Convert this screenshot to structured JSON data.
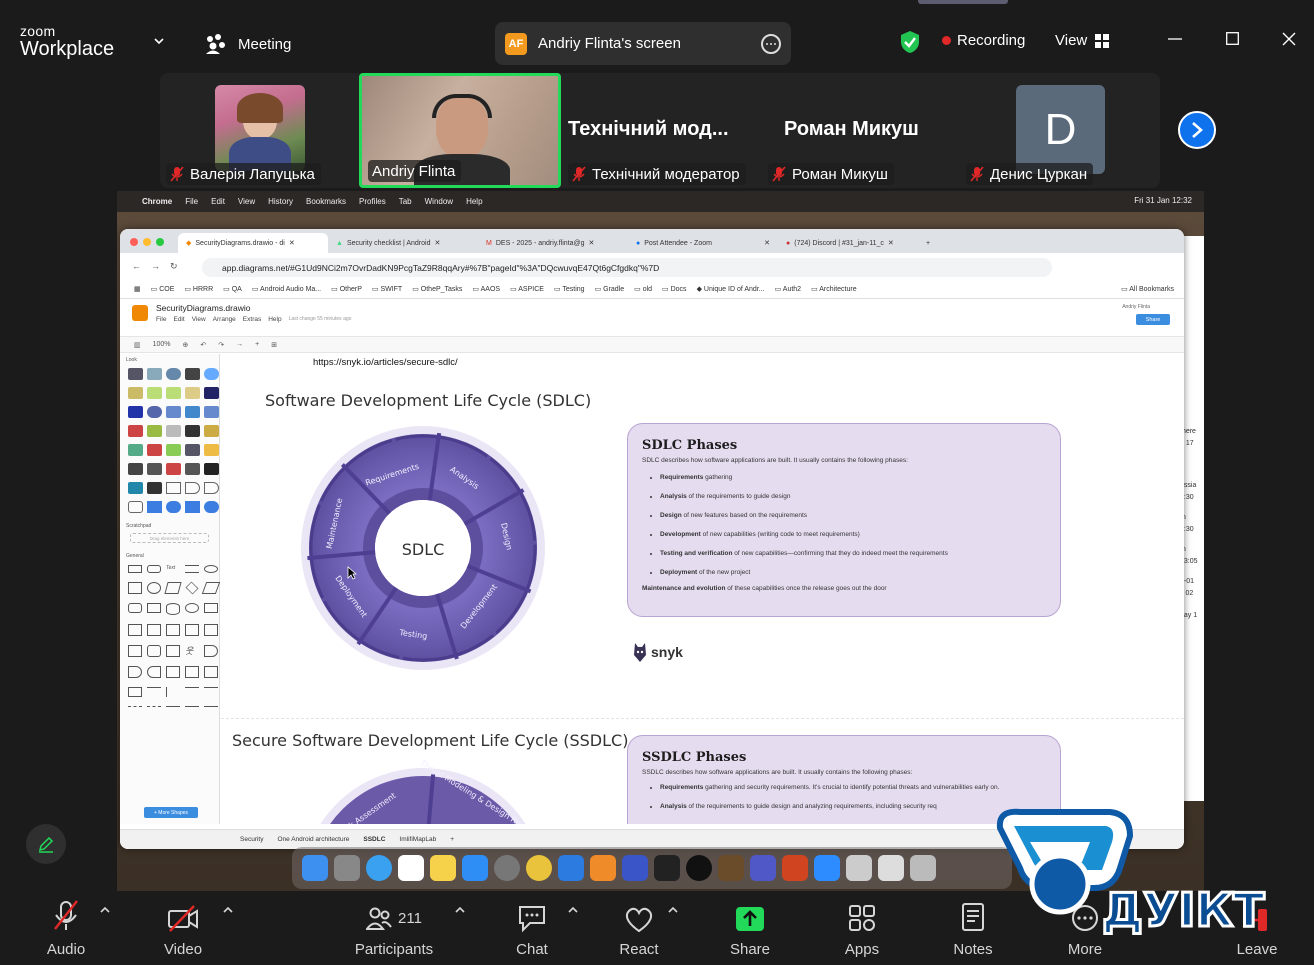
{
  "app": {
    "logo_line1": "zoom",
    "logo_line2": "Workplace"
  },
  "header": {
    "meeting_label": "Meeting",
    "share_initials": "AF",
    "share_label": "Andriy Flinta's screen",
    "recording_label": "Recording",
    "view_label": "View"
  },
  "participants": [
    {
      "name": "Валерія Лапуцька",
      "muted": true
    },
    {
      "name": "Andriy Flinta",
      "muted": false,
      "speaking": true
    },
    {
      "display": "Технічний мод...",
      "name": "Технічний модератор",
      "muted": true
    },
    {
      "display": "Роман Микуш",
      "name": "Роман Микуш",
      "muted": false
    },
    {
      "avatar_letter": "D",
      "name": "Денис Цуркан",
      "muted": true
    }
  ],
  "mac_menu": {
    "items": [
      "Chrome",
      "File",
      "Edit",
      "View",
      "History",
      "Bookmarks",
      "Profiles",
      "Tab",
      "Window",
      "Help"
    ],
    "clock": "Fri 31 Jan  12:32"
  },
  "browser": {
    "tabs": [
      "SecurityDiagrams.drawio - di",
      "Security checklist | Android",
      "DES - 2025 - andriy.flinta@g",
      "Post Attendee - Zoom",
      "(724) Discord | #31_jan-11_c"
    ],
    "url": "app.diagrams.net/#G1Ud9NCi2m7OvrDadKN9PcgTaZ9R8qqAry#%7B\"pageId\"%3A\"DQcwuvqE47Qt6gCfgdkq\"%7D",
    "bookmarks": [
      "COE",
      "HRRR",
      "QA",
      "Android Audio Ma...",
      "OtherP",
      "SWIFT",
      "OtheP_Tasks",
      "AAOS",
      "ASPICE",
      "Testing",
      "Gradle",
      "old",
      "Docs",
      "Unique ID of Andr...",
      "Auth2",
      "Architecture"
    ],
    "all_bookmarks": "All Bookmarks"
  },
  "drawio": {
    "file_title": "SecurityDiagrams.drawio",
    "menu": [
      "File",
      "Edit",
      "View",
      "Arrange",
      "Extras",
      "Help"
    ],
    "last_change": "Last change 55 minutes ago",
    "zoom": "100%",
    "share": "Share",
    "user": "Andriy Flinta",
    "library_title": "Look",
    "scratchpad_label": "Scratchpad",
    "scratchpad_hint": "Drag elements here",
    "general_label": "General",
    "more_shapes": "+ More Shapes",
    "sheets": [
      "Security",
      "One Android architecture",
      "SSDLC",
      "ImlifiMapLab"
    ]
  },
  "diagram": {
    "link": "https://snyk.io/articles/secure-sdlc/",
    "sdlc_title": "Software Development Life Cycle (SDLC)",
    "sdlc_center": "SDLC",
    "sdlc_segments": [
      "Requirements",
      "Analysis",
      "Design",
      "Development",
      "Testing",
      "Deployment",
      "Maintenance"
    ],
    "phases_title": "SDLC Phases",
    "phases_intro": "SDLC describes how software applications are built. It usually contains the following phases:",
    "phases": [
      {
        "bold": "Requirements",
        "rest": " gathering"
      },
      {
        "bold": "Analysis",
        "rest": " of the requirements to guide design"
      },
      {
        "bold": "Design",
        "rest": " of new features based on the requirements"
      },
      {
        "bold": "Development",
        "rest": " of new capabilities (writing code to meet requirements)"
      },
      {
        "bold": "Testing and verification",
        "rest": " of new capabilities—confirming that they do indeed meet the requirements"
      },
      {
        "bold": "Deployment",
        "rest": " of the new project"
      }
    ],
    "phases_footer_bold": "Maintenance and evolution",
    "phases_footer_rest": " of these capabilities once the release goes out the door",
    "snyk": "snyk",
    "ssdlc_title": "Secure Software Development Life Cycle (SSDLC)",
    "ssdlc_segments": [
      "Risk Assessment",
      "Threat Modeling & Design Review"
    ],
    "ssdlc_phases_title": "SSDLC Phases",
    "ssdlc_intro": "SSDLC describes how software applications are built. It usually contains the following phases:",
    "ssdlc_item1_bold": "Requirements",
    "ssdlc_item1_rest": " gathering and security requirements. It's crucial to identify potential threats and vulnerabilities early on.",
    "ssdlc_item2_bold": "Analysis",
    "ssdlc_item2_rest": " of the requirements to guide design and analyzing requirements, including security req"
  },
  "side_window": [
    "/here",
    "4 17",
    "assia",
    "8:30",
    "m",
    "8:30",
    "m",
    "13:05",
    "5-01",
    "y 02",
    "day 1"
  ],
  "toolbar": {
    "audio": "Audio",
    "video": "Video",
    "participants": "Participants",
    "participants_count": "211",
    "chat": "Chat",
    "react": "React",
    "share": "Share",
    "apps": "Apps",
    "notes": "Notes",
    "more": "More",
    "leave": "Leave"
  },
  "watermark": "ДУІКТ",
  "colors": {
    "zoom_blue": "#0e72ed",
    "share_green": "#23d959",
    "speaker_border": "#23d959",
    "sdlc_ring": "#6a5aa8",
    "phase_card": "#e6dcf0",
    "leave_red": "#e02828"
  }
}
